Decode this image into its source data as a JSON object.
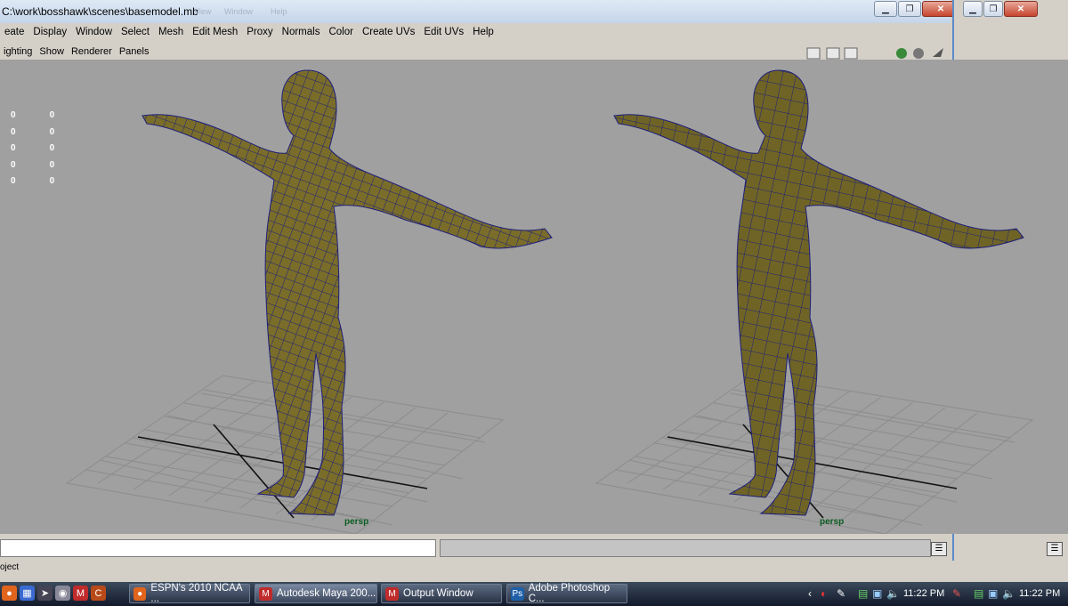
{
  "window": {
    "title": "C:\\work\\bosshawk\\scenes\\basemodel.mb",
    "ghost_menu": [
      "View",
      "Window",
      "Help"
    ]
  },
  "menubar": [
    "eate",
    "Display",
    "Window",
    "Select",
    "Mesh",
    "Edit Mesh",
    "Proxy",
    "Normals",
    "Color",
    "Create UVs",
    "Edit UVs",
    "Help"
  ],
  "panel_menu": [
    "ighting",
    "Show",
    "Renderer",
    "Panels"
  ],
  "hud": {
    "rows": [
      [
        "0",
        "0"
      ],
      [
        "0",
        "0"
      ],
      [
        "0",
        "0"
      ],
      [
        "0",
        "0"
      ],
      [
        "0",
        "0"
      ]
    ]
  },
  "viewports": [
    {
      "label": "persp"
    },
    {
      "label": "persp"
    }
  ],
  "status": {
    "text": "oject"
  },
  "taskbar": {
    "items": [
      {
        "label": "ESPN's 2010 NCAA ...",
        "icon": "firefox-icon",
        "color": "#e0641c"
      },
      {
        "label": "Autodesk Maya 200...",
        "icon": "maya-icon",
        "color": "#c02b2b"
      },
      {
        "label": "Output Window",
        "icon": "maya-icon",
        "color": "#c02b2b"
      },
      {
        "label": "Adobe Photoshop C...",
        "icon": "photoshop-icon",
        "color": "#1f5fa6"
      }
    ],
    "clocks": [
      "11:22 PM",
      "11:22 PM"
    ]
  },
  "colors": {
    "viewport": "#a0a0a0",
    "mesh_fill": "#7a6d2a",
    "wire": "#1d1f7a",
    "grid": "#8a8a8a"
  }
}
